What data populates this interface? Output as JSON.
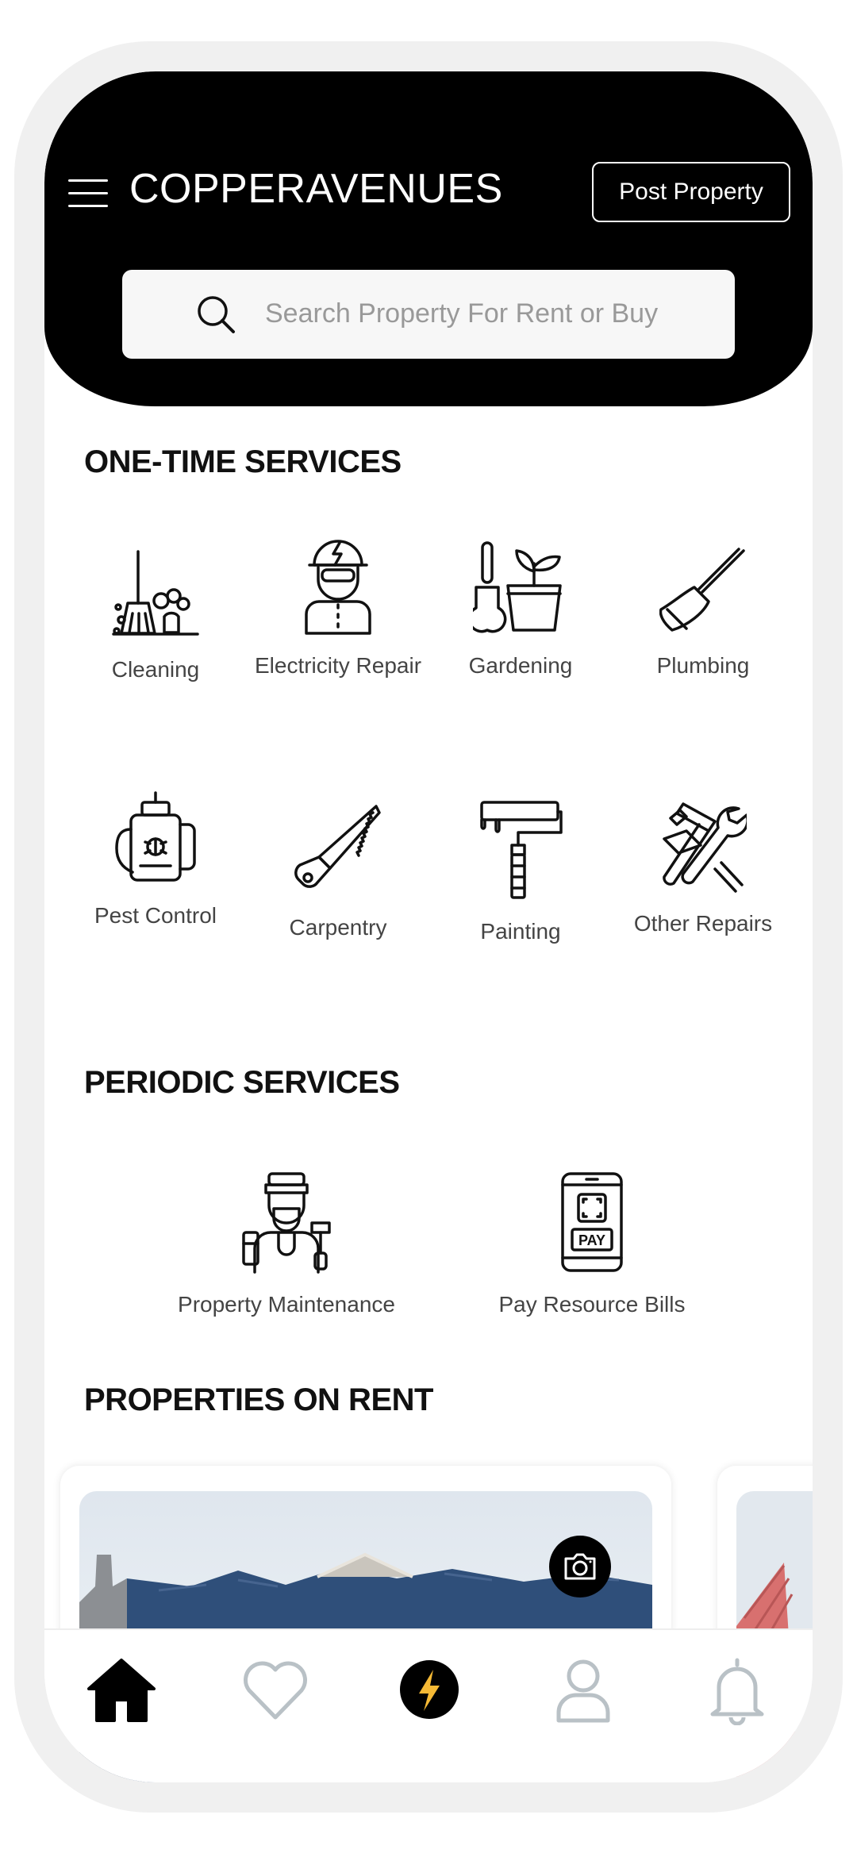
{
  "header": {
    "brand": "COPPERAVENUES",
    "post_property_label": "Post Property",
    "search_placeholder": "Search Property For Rent or Buy"
  },
  "one_time_services": {
    "title": "ONE-TIME SERVICES",
    "items": [
      {
        "label": "Cleaning",
        "icon": "cleaning-icon"
      },
      {
        "label": "Electricity Repair",
        "icon": "electrician-icon"
      },
      {
        "label": "Gardening",
        "icon": "gardening-icon"
      },
      {
        "label": "Plumbing",
        "icon": "plunger-icon"
      },
      {
        "label": "Pest Control",
        "icon": "pest-sprayer-icon"
      },
      {
        "label": "Carpentry",
        "icon": "saw-icon"
      },
      {
        "label": "Painting",
        "icon": "paint-roller-icon"
      },
      {
        "label": "Other Repairs",
        "icon": "tools-icon"
      }
    ]
  },
  "periodic_services": {
    "title": "PERIODIC SERVICES",
    "items": [
      {
        "label": "Property Maintenance",
        "icon": "maintenance-worker-icon"
      },
      {
        "label": "Pay Resource Bills",
        "icon": "phone-pay-icon"
      }
    ]
  },
  "properties_on_rent": {
    "title": "PROPERTIES ON RENT"
  },
  "bottom_nav": [
    {
      "name": "home",
      "icon": "home-icon",
      "active": true
    },
    {
      "name": "favorites",
      "icon": "heart-icon",
      "active": false
    },
    {
      "name": "quick-services",
      "icon": "lightning-icon",
      "active": false
    },
    {
      "name": "profile",
      "icon": "user-icon",
      "active": false
    },
    {
      "name": "notifications",
      "icon": "bell-icon",
      "active": false
    }
  ],
  "colors": {
    "header_bg": "#000000",
    "accent": "#f5b935",
    "inactive_icon": "#b9c1c6"
  }
}
